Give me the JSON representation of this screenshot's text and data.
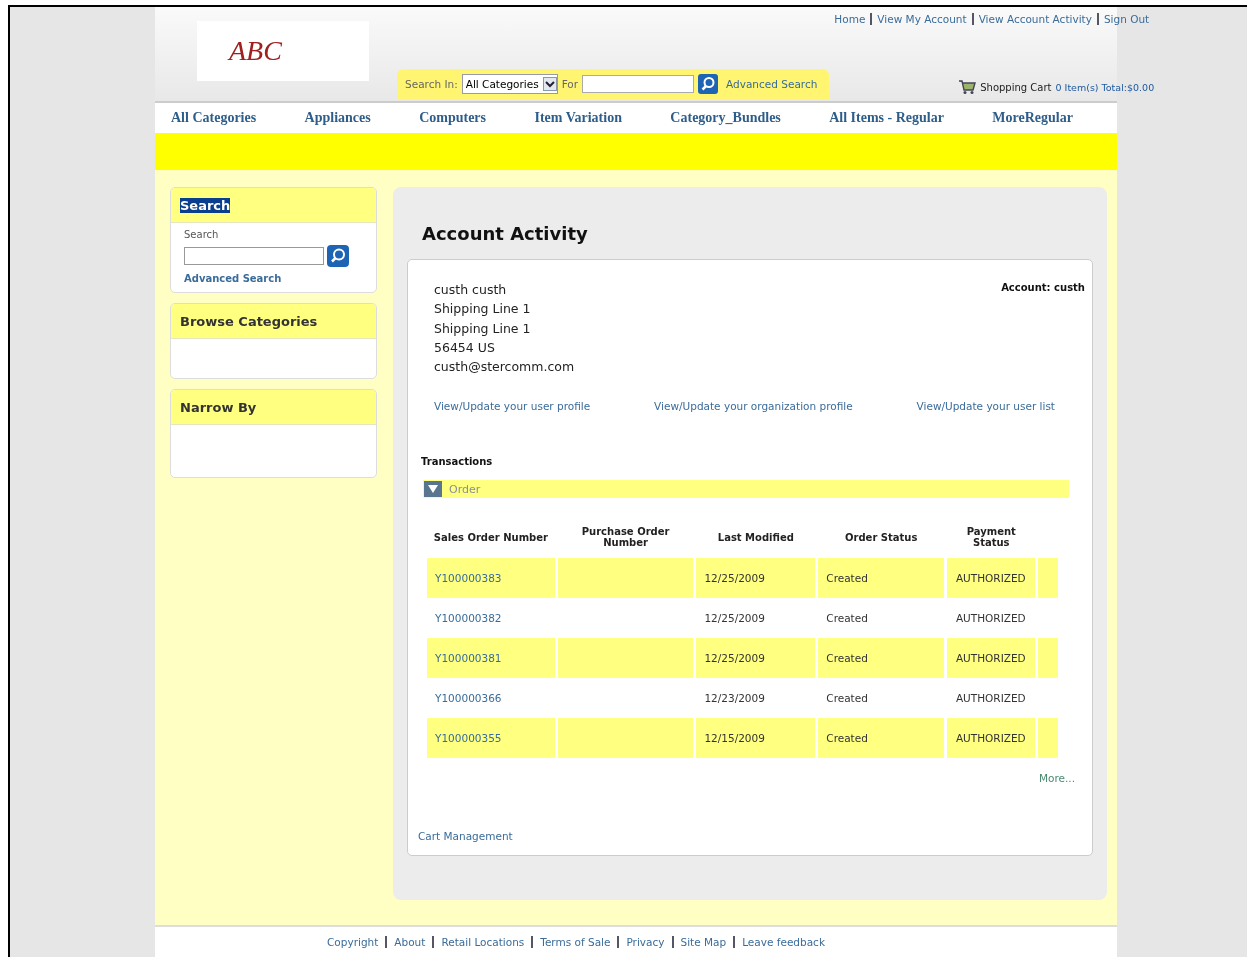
{
  "header": {
    "logo": "ABC",
    "top_links": [
      "Home",
      "View My Account",
      "View Account Activity",
      "Sign Out"
    ],
    "search": {
      "label": "Search In:",
      "category": "All Categories",
      "for_label": "For",
      "advanced": "Advanced Search"
    },
    "cart": {
      "label": "Shopping Cart",
      "summary": "0 Item(s) Total:$0.00"
    }
  },
  "nav": [
    "All Categories",
    "Appliances",
    "Computers",
    "Item Variation",
    "Category_Bundles",
    "All Items - Regular",
    "MoreRegular"
  ],
  "sidebar": {
    "boxes": [
      {
        "kind": "search",
        "title": "Search",
        "highlighted": true,
        "field_label": "Search",
        "link": "Advanced Search"
      },
      {
        "kind": "empty",
        "title": "Browse Categories",
        "highlighted": false
      },
      {
        "kind": "empty",
        "title": "Narrow By",
        "highlighted": false
      }
    ]
  },
  "page_title": "Account Activity",
  "account": {
    "address": [
      "custh custh",
      "Shipping Line 1",
      "Shipping Line 1",
      "56454 US",
      "custh@stercomm.com"
    ],
    "account_label": "Account: custh",
    "links": [
      "View/Update your user profile",
      "View/Update your organization profile",
      "View/Update your user list"
    ]
  },
  "transactions": {
    "title": "Transactions",
    "section": "Order",
    "expanded": true,
    "columns": [
      "Sales Order Number",
      "Purchase Order Number",
      "Last Modified",
      "Order Status",
      "Payment Status"
    ],
    "rows": [
      {
        "sales_order": "Y100000383",
        "last_modified": "12/25/2009",
        "order_status": "Created",
        "payment_status": "AUTHORIZED",
        "highlighted": true
      },
      {
        "sales_order": "Y100000382",
        "last_modified": "12/25/2009",
        "order_status": "Created",
        "payment_status": "AUTHORIZED",
        "highlighted": false
      },
      {
        "sales_order": "Y100000381",
        "last_modified": "12/25/2009",
        "order_status": "Created",
        "payment_status": "AUTHORIZED",
        "highlighted": true
      },
      {
        "sales_order": "Y100000366",
        "last_modified": "12/23/2009",
        "order_status": "Created",
        "payment_status": "AUTHORIZED",
        "highlighted": false
      },
      {
        "sales_order": "Y100000355",
        "last_modified": "12/15/2009",
        "order_status": "Created",
        "payment_status": "AUTHORIZED",
        "highlighted": true
      }
    ],
    "more": "More..."
  },
  "cart_management": "Cart Management",
  "footer": [
    "Copyright",
    "About",
    "Retail Locations",
    "Terms of Sale",
    "Privacy",
    "Site Map",
    "Leave feedback"
  ]
}
